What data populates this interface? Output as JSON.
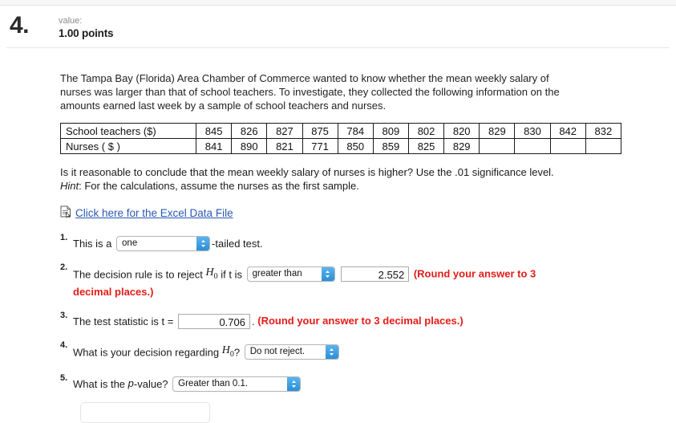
{
  "header": {
    "question_number": "4.",
    "value_label": "value:",
    "points": "1.00 points"
  },
  "prompt": {
    "paragraph": "The Tampa Bay (Florida) Area Chamber of Commerce wanted to know whether the mean weekly salary of nurses was larger than that of school teachers. To investigate, they collected the following information on the amounts earned last week by a sample of school teachers and nurses.",
    "question": "Is it reasonable to conclude that the mean weekly salary of nurses is higher? Use the .01 significance level.",
    "hint_label": "Hint",
    "hint_text": ": For the calculations, assume the nurses as the first sample."
  },
  "data_table": {
    "rows": [
      {
        "label": "School teachers ($)",
        "values": [
          "845",
          "826",
          "827",
          "875",
          "784",
          "809",
          "802",
          "820",
          "829",
          "830",
          "842",
          "832"
        ]
      },
      {
        "label": "Nurses ( $ )",
        "values": [
          "841",
          "890",
          "821",
          "771",
          "850",
          "859",
          "825",
          "829",
          "",
          "",
          "",
          ""
        ]
      }
    ]
  },
  "excel": {
    "icon": "spreadsheet-document-icon",
    "link_text": "Click here for the Excel Data File"
  },
  "items": [
    {
      "number": "1.",
      "text_before": "This is a",
      "select_value": "one",
      "text_after": "-tailed test."
    },
    {
      "number": "2.",
      "text_before": "The decision rule is to reject",
      "symbol": "H",
      "symbol_sub": "0",
      "text_middle": "if t is",
      "select_value": "greater than",
      "input_value": "2.552",
      "note": "(Round your answer to 3 decimal places.)"
    },
    {
      "number": "3.",
      "text_before": "The test statistic is t =",
      "input_value": "0.706",
      "text_after": ".",
      "note": "(Round your answer to 3 decimal places.)"
    },
    {
      "number": "4.",
      "text_before": "What is your decision regarding",
      "symbol": "H",
      "symbol_sub": "0",
      "text_after": "?",
      "select_value": "Do not reject."
    },
    {
      "number": "5.",
      "text_before": "What is the",
      "italic_part": "p",
      "text_after": "-value?",
      "select_value": "Greater than 0.1."
    }
  ],
  "colors": {
    "link": "#2a58b5",
    "note_red": "#e41b17",
    "select_arrow_blue": "#2b8fd8"
  }
}
